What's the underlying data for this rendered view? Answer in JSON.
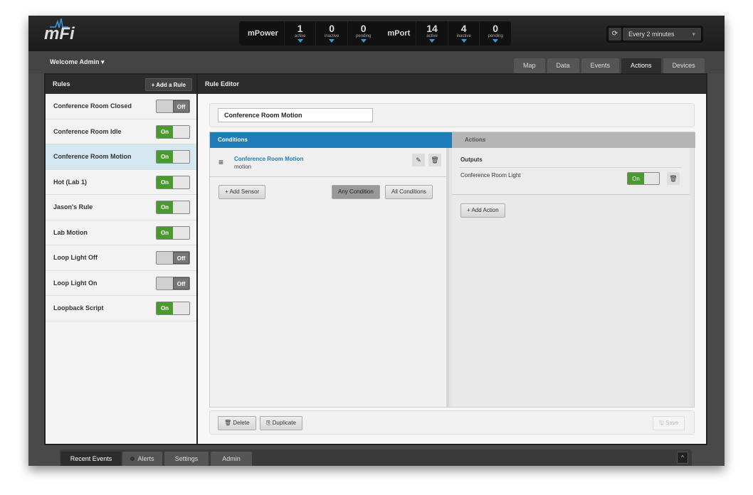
{
  "app": {
    "logo": "mFi"
  },
  "stats": {
    "groups": [
      {
        "name": "mPower",
        "items": [
          {
            "value": "1",
            "label": "active"
          },
          {
            "value": "0",
            "label": "inactive"
          },
          {
            "value": "0",
            "label": "pending"
          }
        ]
      },
      {
        "name": "mPort",
        "items": [
          {
            "value": "14",
            "label": "active"
          },
          {
            "value": "4",
            "label": "inactive"
          },
          {
            "value": "0",
            "label": "pending"
          }
        ]
      }
    ]
  },
  "refresh": {
    "value": "Every 2 minutes",
    "icon": "refresh-icon"
  },
  "welcome": "Welcome Admin ▾",
  "tabs": [
    "Map",
    "Data",
    "Events",
    "Actions",
    "Devices"
  ],
  "active_tab": "Actions",
  "sidebar": {
    "title": "Rules",
    "add_label": "+ Add a Rule",
    "rules": [
      {
        "name": "Conference Room Closed",
        "state": "Off"
      },
      {
        "name": "Conference Room Idle",
        "state": "On"
      },
      {
        "name": "Conference Room Motion",
        "state": "On",
        "selected": true
      },
      {
        "name": "Hot (Lab 1)",
        "state": "On"
      },
      {
        "name": "Jason's Rule",
        "state": "On"
      },
      {
        "name": "Lab Motion",
        "state": "On"
      },
      {
        "name": "Loop Light Off",
        "state": "Off"
      },
      {
        "name": "Loop Light On",
        "state": "Off"
      },
      {
        "name": "Loopback Script",
        "state": "On"
      }
    ]
  },
  "editor": {
    "title": "Rule Editor",
    "rule_name": "Conference Room Motion",
    "conditions_label": "Conditions",
    "actions_label": "Actions",
    "condition": {
      "name": "Conference Room Motion",
      "type": "motion"
    },
    "add_sensor": "+ Add Sensor",
    "any_condition": "Any Condition",
    "all_conditions": "All Conditions",
    "outputs_label": "Outputs",
    "output": {
      "name": "Conference Room Light",
      "state": "On"
    },
    "add_action": "+ Add Action",
    "delete": "Delete",
    "duplicate": "Duplicate",
    "save": "Save"
  },
  "bottom_tabs": [
    "Recent Events",
    "Alerts",
    "Settings",
    "Admin"
  ],
  "colors": {
    "accent": "#1e7db8",
    "on": "#4a9a2e"
  }
}
